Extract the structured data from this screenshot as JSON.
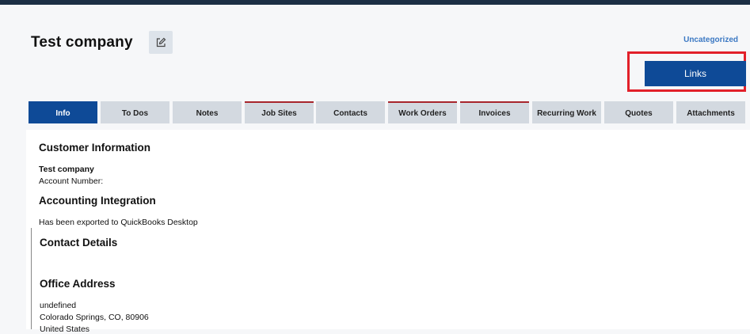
{
  "header": {
    "title": "Test company",
    "category": "Uncategorized",
    "links_label": "Links"
  },
  "tabs": [
    {
      "label": "Info"
    },
    {
      "label": "To Dos"
    },
    {
      "label": "Notes"
    },
    {
      "label": "Job Sites"
    },
    {
      "label": "Contacts"
    },
    {
      "label": "Work Orders"
    },
    {
      "label": "Invoices"
    },
    {
      "label": "Recurring Work"
    },
    {
      "label": "Quotes"
    },
    {
      "label": "Attachments"
    }
  ],
  "customer_info": {
    "heading": "Customer Information",
    "name": "Test company",
    "account_number_label": "Account Number:"
  },
  "accounting": {
    "heading": "Accounting Integration",
    "status": "Has been exported to QuickBooks Desktop"
  },
  "contact_details": {
    "heading": "Contact Details"
  },
  "office_address": {
    "heading": "Office Address",
    "line1": "undefined",
    "line2": "Colorado Springs, CO, 80906",
    "line3": "United States"
  },
  "colors": {
    "primary": "#0e4a97",
    "highlight": "#e2202a",
    "tab_flag": "#a8262c"
  }
}
